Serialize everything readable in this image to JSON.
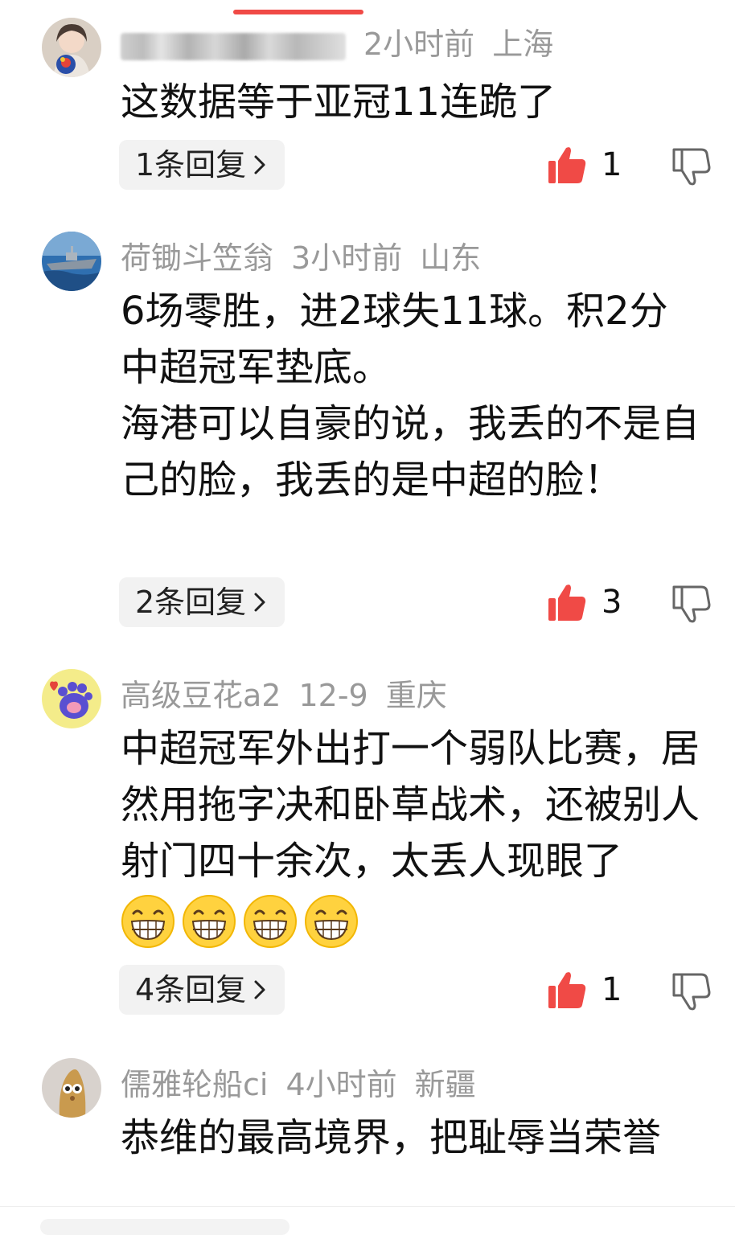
{
  "theme": {
    "accent": "#f04a46",
    "meta_text": "#999999",
    "pill_bg": "#f2f2f2",
    "like_color": "#f04a46"
  },
  "comments": [
    {
      "name": "",
      "time": "2小时前",
      "location": "上海",
      "text": "这数据等于亚冠11连跪了",
      "replies": "1条回复",
      "likes": "1",
      "avatar_icon": "girl-avatar-icon"
    },
    {
      "name": "荷锄斗笠翁",
      "time": "3小时前",
      "location": "山东",
      "text": "6场零胜，进2球失11球。积2分中超冠军垫底。\n海港可以自豪的说，我丢的不是自己的脸，我丢的是中超的脸！",
      "replies": "2条回复",
      "likes": "3",
      "avatar_icon": "warship-avatar-icon"
    },
    {
      "name": "高级豆花a2",
      "time": "12-9",
      "location": "重庆",
      "text": "中超冠军外出打一个弱队比赛，居然用拖字决和卧草战术，还被别人射门四十余次，太丢人现眼了",
      "emojis": [
        "grinning-face-icon",
        "grinning-face-icon",
        "grinning-face-icon",
        "grinning-face-icon"
      ],
      "replies": "4条回复",
      "likes": "1",
      "avatar_icon": "paw-avatar-icon"
    },
    {
      "name": "儒雅轮船ci",
      "time": "4小时前",
      "location": "新疆",
      "text": "恭维的最高境界，把耻辱当荣誉",
      "avatar_icon": "cartoon-avatar-icon"
    }
  ]
}
